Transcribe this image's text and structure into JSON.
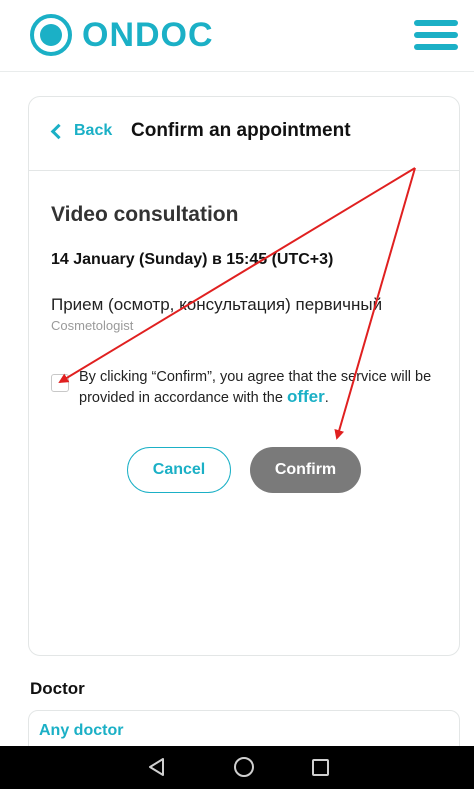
{
  "header": {
    "brand": "ONDOC",
    "menu_icon": "hamburger-menu-icon",
    "brand_color": "#1bb0c6"
  },
  "card": {
    "back_label": "Back",
    "title": "Confirm an appointment",
    "visit_type": "Video consultation",
    "date_time": "14 January (Sunday) в 15:45 (UTC+3)",
    "service": "Прием (осмотр, консультация) первичный",
    "specialty": "Cosmetologist",
    "agreement_text": "By clicking “Confirm”, you agree that the service will be provided in accordance with the ",
    "agreement_link": "offer",
    "agreement_end": ".",
    "checkbox_checked": false,
    "cancel_label": "Cancel",
    "confirm_label": "Confirm",
    "confirm_color": "#7a7a7a"
  },
  "doctor_section": {
    "title": "Doctor",
    "selected": "Any doctor"
  },
  "annotations": {
    "arrow_color": "#e02020"
  },
  "system_nav": {
    "icons": [
      "back-triangle-icon",
      "home-circle-icon",
      "recent-apps-square-icon"
    ]
  }
}
